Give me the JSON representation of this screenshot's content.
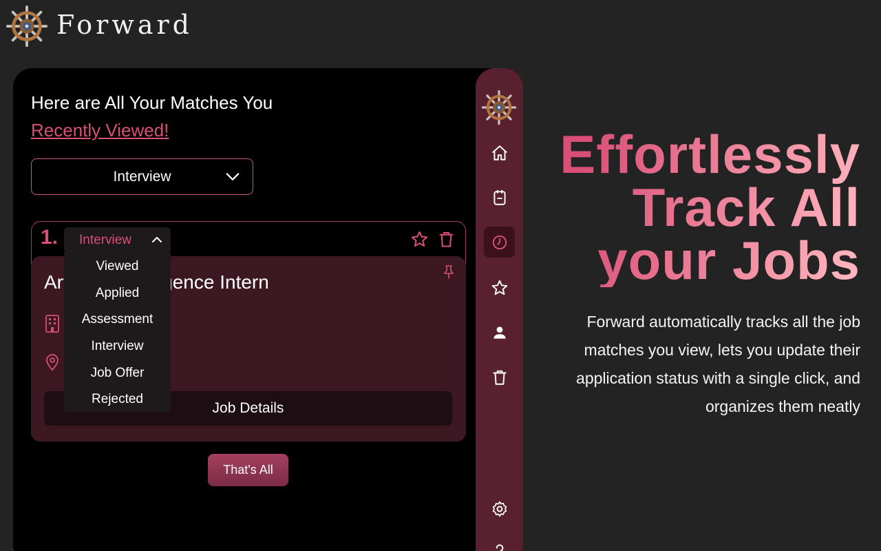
{
  "brand": {
    "name": "Forward"
  },
  "heading": {
    "line1": "Here are All Your Matches You",
    "accent": "Recently Viewed!"
  },
  "filter": {
    "selected": "Interview"
  },
  "card": {
    "index": "1.",
    "status": "Interview",
    "title": "Artificial Intelligence Intern",
    "details_label": "Job Details"
  },
  "status_options": [
    "Viewed",
    "Applied",
    "Assessment",
    "Interview",
    "Job Offer",
    "Rejected"
  ],
  "thats_all_label": "That's All",
  "hero": {
    "title_line1": "Effortlessly",
    "title_line2": "Track All",
    "title_line3": "your Jobs",
    "description": "Forward automatically tracks all the job matches you view, lets you update their application status with a single click, and organizes them neatly"
  },
  "sidebar": {
    "items": [
      {
        "icon": "home-icon"
      },
      {
        "icon": "clipboard-icon"
      },
      {
        "icon": "clock-icon",
        "active": true
      },
      {
        "icon": "star-icon"
      },
      {
        "icon": "user-icon"
      },
      {
        "icon": "trash-icon"
      },
      {
        "icon": "gear-icon"
      },
      {
        "icon": "help-icon"
      }
    ]
  },
  "colors": {
    "accent": "#d94f76",
    "sidebar": "#59202f",
    "card": "#3b1822",
    "background": "#232323"
  }
}
